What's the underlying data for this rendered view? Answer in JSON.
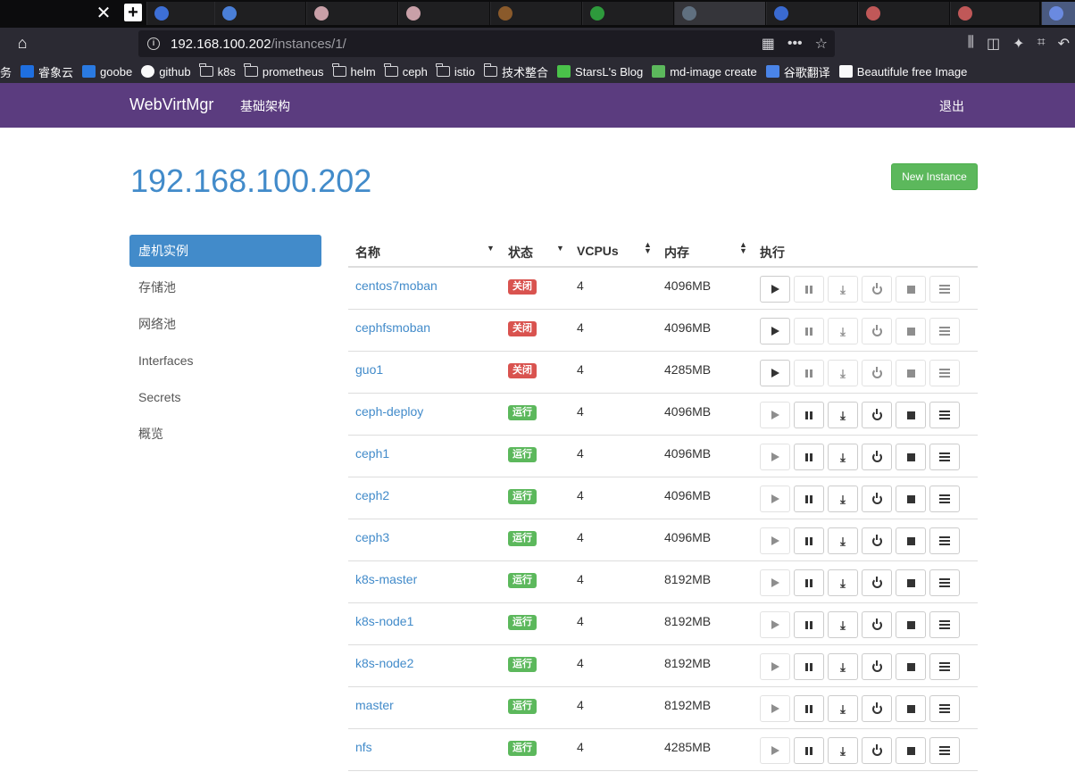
{
  "browser": {
    "url_host": "192.168.100.202",
    "url_path": "/instances/1/",
    "bookmarks": [
      {
        "label": "务",
        "icon": "none"
      },
      {
        "label": "睿象云",
        "icon": "logo-icon"
      },
      {
        "label": "goobe",
        "icon": "g-icon"
      },
      {
        "label": "github",
        "icon": "github-icon"
      },
      {
        "label": "k8s",
        "icon": "folder-icon"
      },
      {
        "label": "prometheus",
        "icon": "folder-icon"
      },
      {
        "label": "helm",
        "icon": "folder-icon"
      },
      {
        "label": "ceph",
        "icon": "folder-icon"
      },
      {
        "label": "istio",
        "icon": "folder-icon"
      },
      {
        "label": "技术整合",
        "icon": "folder-icon"
      },
      {
        "label": "StarsL's Blog",
        "icon": "star-icon"
      },
      {
        "label": "md-image create",
        "icon": "chart-icon"
      },
      {
        "label": "谷歌翻译",
        "icon": "translate-icon"
      },
      {
        "label": "Beautifule free Image",
        "icon": "camera-icon"
      }
    ]
  },
  "app": {
    "brand": "WebVirtMgr",
    "nav_item": "基础架构",
    "logout": "退出"
  },
  "page": {
    "title": "192.168.100.202",
    "new_instance": "New Instance"
  },
  "sidebar": {
    "items": [
      {
        "label": "虚机实例",
        "active": true
      },
      {
        "label": "存储池",
        "active": false
      },
      {
        "label": "网络池",
        "active": false
      },
      {
        "label": "Interfaces",
        "active": false
      },
      {
        "label": "Secrets",
        "active": false
      },
      {
        "label": "概览",
        "active": false
      }
    ]
  },
  "table": {
    "headers": {
      "name": "名称",
      "status": "状态",
      "vcpus": "VCPUs",
      "memory": "内存",
      "actions": "执行"
    },
    "rows": [
      {
        "name": "centos7moban",
        "status": "关闭",
        "state": "off",
        "vcpus": "4",
        "memory": "4096MB"
      },
      {
        "name": "cephfsmoban",
        "status": "关闭",
        "state": "off",
        "vcpus": "4",
        "memory": "4096MB"
      },
      {
        "name": "guo1",
        "status": "关闭",
        "state": "off",
        "vcpus": "4",
        "memory": "4285MB"
      },
      {
        "name": "ceph-deploy",
        "status": "运行",
        "state": "on",
        "vcpus": "4",
        "memory": "4096MB"
      },
      {
        "name": "ceph1",
        "status": "运行",
        "state": "on",
        "vcpus": "4",
        "memory": "4096MB"
      },
      {
        "name": "ceph2",
        "status": "运行",
        "state": "on",
        "vcpus": "4",
        "memory": "4096MB"
      },
      {
        "name": "ceph3",
        "status": "运行",
        "state": "on",
        "vcpus": "4",
        "memory": "4096MB"
      },
      {
        "name": "k8s-master",
        "status": "运行",
        "state": "on",
        "vcpus": "4",
        "memory": "8192MB"
      },
      {
        "name": "k8s-node1",
        "status": "运行",
        "state": "on",
        "vcpus": "4",
        "memory": "8192MB"
      },
      {
        "name": "k8s-node2",
        "status": "运行",
        "state": "on",
        "vcpus": "4",
        "memory": "8192MB"
      },
      {
        "name": "master",
        "status": "运行",
        "state": "on",
        "vcpus": "4",
        "memory": "8192MB"
      },
      {
        "name": "nfs",
        "status": "运行",
        "state": "on",
        "vcpus": "4",
        "memory": "4285MB"
      }
    ]
  },
  "colors": {
    "navbar": "#5b3c7f",
    "primary": "#428bca",
    "success": "#5cb85c",
    "danger": "#d9534f"
  }
}
